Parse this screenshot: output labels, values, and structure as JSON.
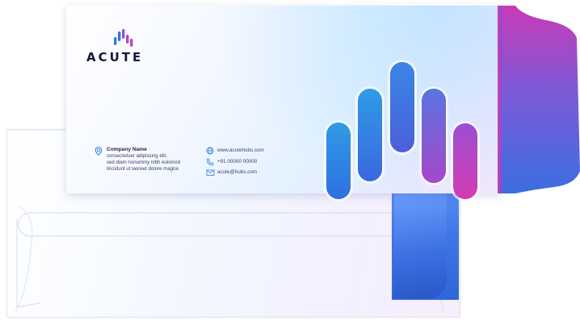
{
  "brand": {
    "logo_text": "ACUTE",
    "logo_icon": "bar-chart-logo"
  },
  "company": {
    "icon": "building-icon",
    "name": "Company Name",
    "lines": [
      "consectetuer adipiscing elit,",
      "sed diam nonummy nibh euismod",
      "tincidunt ut laoreet dolore magna"
    ]
  },
  "contacts": [
    {
      "icon": "globe-icon",
      "text": "www.acutehubs.com"
    },
    {
      "icon": "phone-icon",
      "text": "+91 00000 00000"
    },
    {
      "icon": "mail-icon",
      "text": "acute@hubs.com"
    }
  ],
  "colors": {
    "brand_blue": "#2f7de1",
    "brand_purple": "#9a4fd6",
    "brand_magenta": "#d13fb8",
    "dark_text": "#141a3a"
  }
}
